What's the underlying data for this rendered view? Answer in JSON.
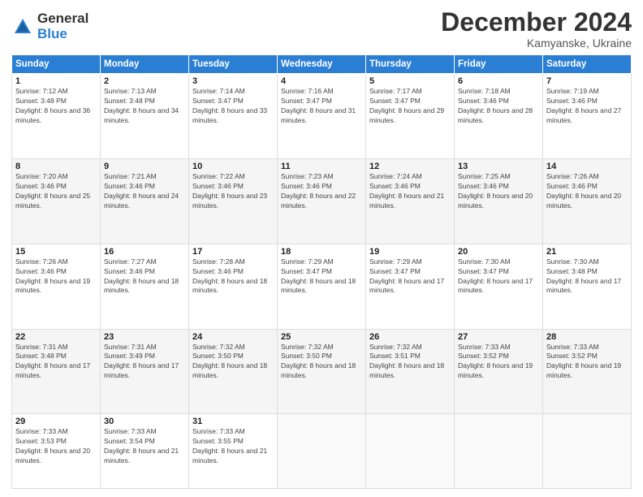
{
  "logo": {
    "general": "General",
    "blue": "Blue"
  },
  "title": "December 2024",
  "location": "Kamyanske, Ukraine",
  "weekdays": [
    "Sunday",
    "Monday",
    "Tuesday",
    "Wednesday",
    "Thursday",
    "Friday",
    "Saturday"
  ],
  "weeks": [
    [
      {
        "day": "1",
        "sunrise": "Sunrise: 7:12 AM",
        "sunset": "Sunset: 3:48 PM",
        "daylight": "Daylight: 8 hours and 36 minutes."
      },
      {
        "day": "2",
        "sunrise": "Sunrise: 7:13 AM",
        "sunset": "Sunset: 3:48 PM",
        "daylight": "Daylight: 8 hours and 34 minutes."
      },
      {
        "day": "3",
        "sunrise": "Sunrise: 7:14 AM",
        "sunset": "Sunset: 3:47 PM",
        "daylight": "Daylight: 8 hours and 33 minutes."
      },
      {
        "day": "4",
        "sunrise": "Sunrise: 7:16 AM",
        "sunset": "Sunset: 3:47 PM",
        "daylight": "Daylight: 8 hours and 31 minutes."
      },
      {
        "day": "5",
        "sunrise": "Sunrise: 7:17 AM",
        "sunset": "Sunset: 3:47 PM",
        "daylight": "Daylight: 8 hours and 29 minutes."
      },
      {
        "day": "6",
        "sunrise": "Sunrise: 7:18 AM",
        "sunset": "Sunset: 3:46 PM",
        "daylight": "Daylight: 8 hours and 28 minutes."
      },
      {
        "day": "7",
        "sunrise": "Sunrise: 7:19 AM",
        "sunset": "Sunset: 3:46 PM",
        "daylight": "Daylight: 8 hours and 27 minutes."
      }
    ],
    [
      {
        "day": "8",
        "sunrise": "Sunrise: 7:20 AM",
        "sunset": "Sunset: 3:46 PM",
        "daylight": "Daylight: 8 hours and 25 minutes."
      },
      {
        "day": "9",
        "sunrise": "Sunrise: 7:21 AM",
        "sunset": "Sunset: 3:46 PM",
        "daylight": "Daylight: 8 hours and 24 minutes."
      },
      {
        "day": "10",
        "sunrise": "Sunrise: 7:22 AM",
        "sunset": "Sunset: 3:46 PM",
        "daylight": "Daylight: 8 hours and 23 minutes."
      },
      {
        "day": "11",
        "sunrise": "Sunrise: 7:23 AM",
        "sunset": "Sunset: 3:46 PM",
        "daylight": "Daylight: 8 hours and 22 minutes."
      },
      {
        "day": "12",
        "sunrise": "Sunrise: 7:24 AM",
        "sunset": "Sunset: 3:46 PM",
        "daylight": "Daylight: 8 hours and 21 minutes."
      },
      {
        "day": "13",
        "sunrise": "Sunrise: 7:25 AM",
        "sunset": "Sunset: 3:46 PM",
        "daylight": "Daylight: 8 hours and 20 minutes."
      },
      {
        "day": "14",
        "sunrise": "Sunrise: 7:26 AM",
        "sunset": "Sunset: 3:46 PM",
        "daylight": "Daylight: 8 hours and 20 minutes."
      }
    ],
    [
      {
        "day": "15",
        "sunrise": "Sunrise: 7:26 AM",
        "sunset": "Sunset: 3:46 PM",
        "daylight": "Daylight: 8 hours and 19 minutes."
      },
      {
        "day": "16",
        "sunrise": "Sunrise: 7:27 AM",
        "sunset": "Sunset: 3:46 PM",
        "daylight": "Daylight: 8 hours and 18 minutes."
      },
      {
        "day": "17",
        "sunrise": "Sunrise: 7:28 AM",
        "sunset": "Sunset: 3:46 PM",
        "daylight": "Daylight: 8 hours and 18 minutes."
      },
      {
        "day": "18",
        "sunrise": "Sunrise: 7:29 AM",
        "sunset": "Sunset: 3:47 PM",
        "daylight": "Daylight: 8 hours and 18 minutes."
      },
      {
        "day": "19",
        "sunrise": "Sunrise: 7:29 AM",
        "sunset": "Sunset: 3:47 PM",
        "daylight": "Daylight: 8 hours and 17 minutes."
      },
      {
        "day": "20",
        "sunrise": "Sunrise: 7:30 AM",
        "sunset": "Sunset: 3:47 PM",
        "daylight": "Daylight: 8 hours and 17 minutes."
      },
      {
        "day": "21",
        "sunrise": "Sunrise: 7:30 AM",
        "sunset": "Sunset: 3:48 PM",
        "daylight": "Daylight: 8 hours and 17 minutes."
      }
    ],
    [
      {
        "day": "22",
        "sunrise": "Sunrise: 7:31 AM",
        "sunset": "Sunset: 3:48 PM",
        "daylight": "Daylight: 8 hours and 17 minutes."
      },
      {
        "day": "23",
        "sunrise": "Sunrise: 7:31 AM",
        "sunset": "Sunset: 3:49 PM",
        "daylight": "Daylight: 8 hours and 17 minutes."
      },
      {
        "day": "24",
        "sunrise": "Sunrise: 7:32 AM",
        "sunset": "Sunset: 3:50 PM",
        "daylight": "Daylight: 8 hours and 18 minutes."
      },
      {
        "day": "25",
        "sunrise": "Sunrise: 7:32 AM",
        "sunset": "Sunset: 3:50 PM",
        "daylight": "Daylight: 8 hours and 18 minutes."
      },
      {
        "day": "26",
        "sunrise": "Sunrise: 7:32 AM",
        "sunset": "Sunset: 3:51 PM",
        "daylight": "Daylight: 8 hours and 18 minutes."
      },
      {
        "day": "27",
        "sunrise": "Sunrise: 7:33 AM",
        "sunset": "Sunset: 3:52 PM",
        "daylight": "Daylight: 8 hours and 19 minutes."
      },
      {
        "day": "28",
        "sunrise": "Sunrise: 7:33 AM",
        "sunset": "Sunset: 3:52 PM",
        "daylight": "Daylight: 8 hours and 19 minutes."
      }
    ],
    [
      {
        "day": "29",
        "sunrise": "Sunrise: 7:33 AM",
        "sunset": "Sunset: 3:53 PM",
        "daylight": "Daylight: 8 hours and 20 minutes."
      },
      {
        "day": "30",
        "sunrise": "Sunrise: 7:33 AM",
        "sunset": "Sunset: 3:54 PM",
        "daylight": "Daylight: 8 hours and 21 minutes."
      },
      {
        "day": "31",
        "sunrise": "Sunrise: 7:33 AM",
        "sunset": "Sunset: 3:55 PM",
        "daylight": "Daylight: 8 hours and 21 minutes."
      },
      null,
      null,
      null,
      null
    ]
  ]
}
